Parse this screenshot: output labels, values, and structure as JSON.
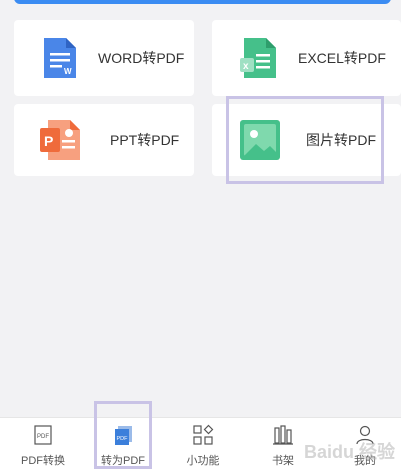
{
  "colors": {
    "accent": "#3b8cf2",
    "word": "#4a86e8",
    "excel": "#45c08a",
    "ppt": "#ef6b3b",
    "image": "#45c08a",
    "highlight": "#c9c3e6"
  },
  "cards": {
    "word": {
      "label": "WORD转PDF",
      "icon": "word-doc-icon"
    },
    "excel": {
      "label": "EXCEL转PDF",
      "icon": "excel-doc-icon"
    },
    "ppt": {
      "label": "PPT转PDF",
      "icon": "ppt-doc-icon"
    },
    "image": {
      "label": "图片转PDF",
      "icon": "image-icon"
    }
  },
  "tabbar": {
    "tabs": [
      {
        "label": "PDF转换",
        "icon": "pdf-doc-icon"
      },
      {
        "label": "转为PDF",
        "icon": "pdf-file-icon",
        "selected": true
      },
      {
        "label": "小功能",
        "icon": "grid-icon"
      },
      {
        "label": "书架",
        "icon": "bookshelf-icon"
      },
      {
        "label": "我的",
        "icon": "user-icon"
      }
    ]
  },
  "watermark": "Baidu 经验"
}
